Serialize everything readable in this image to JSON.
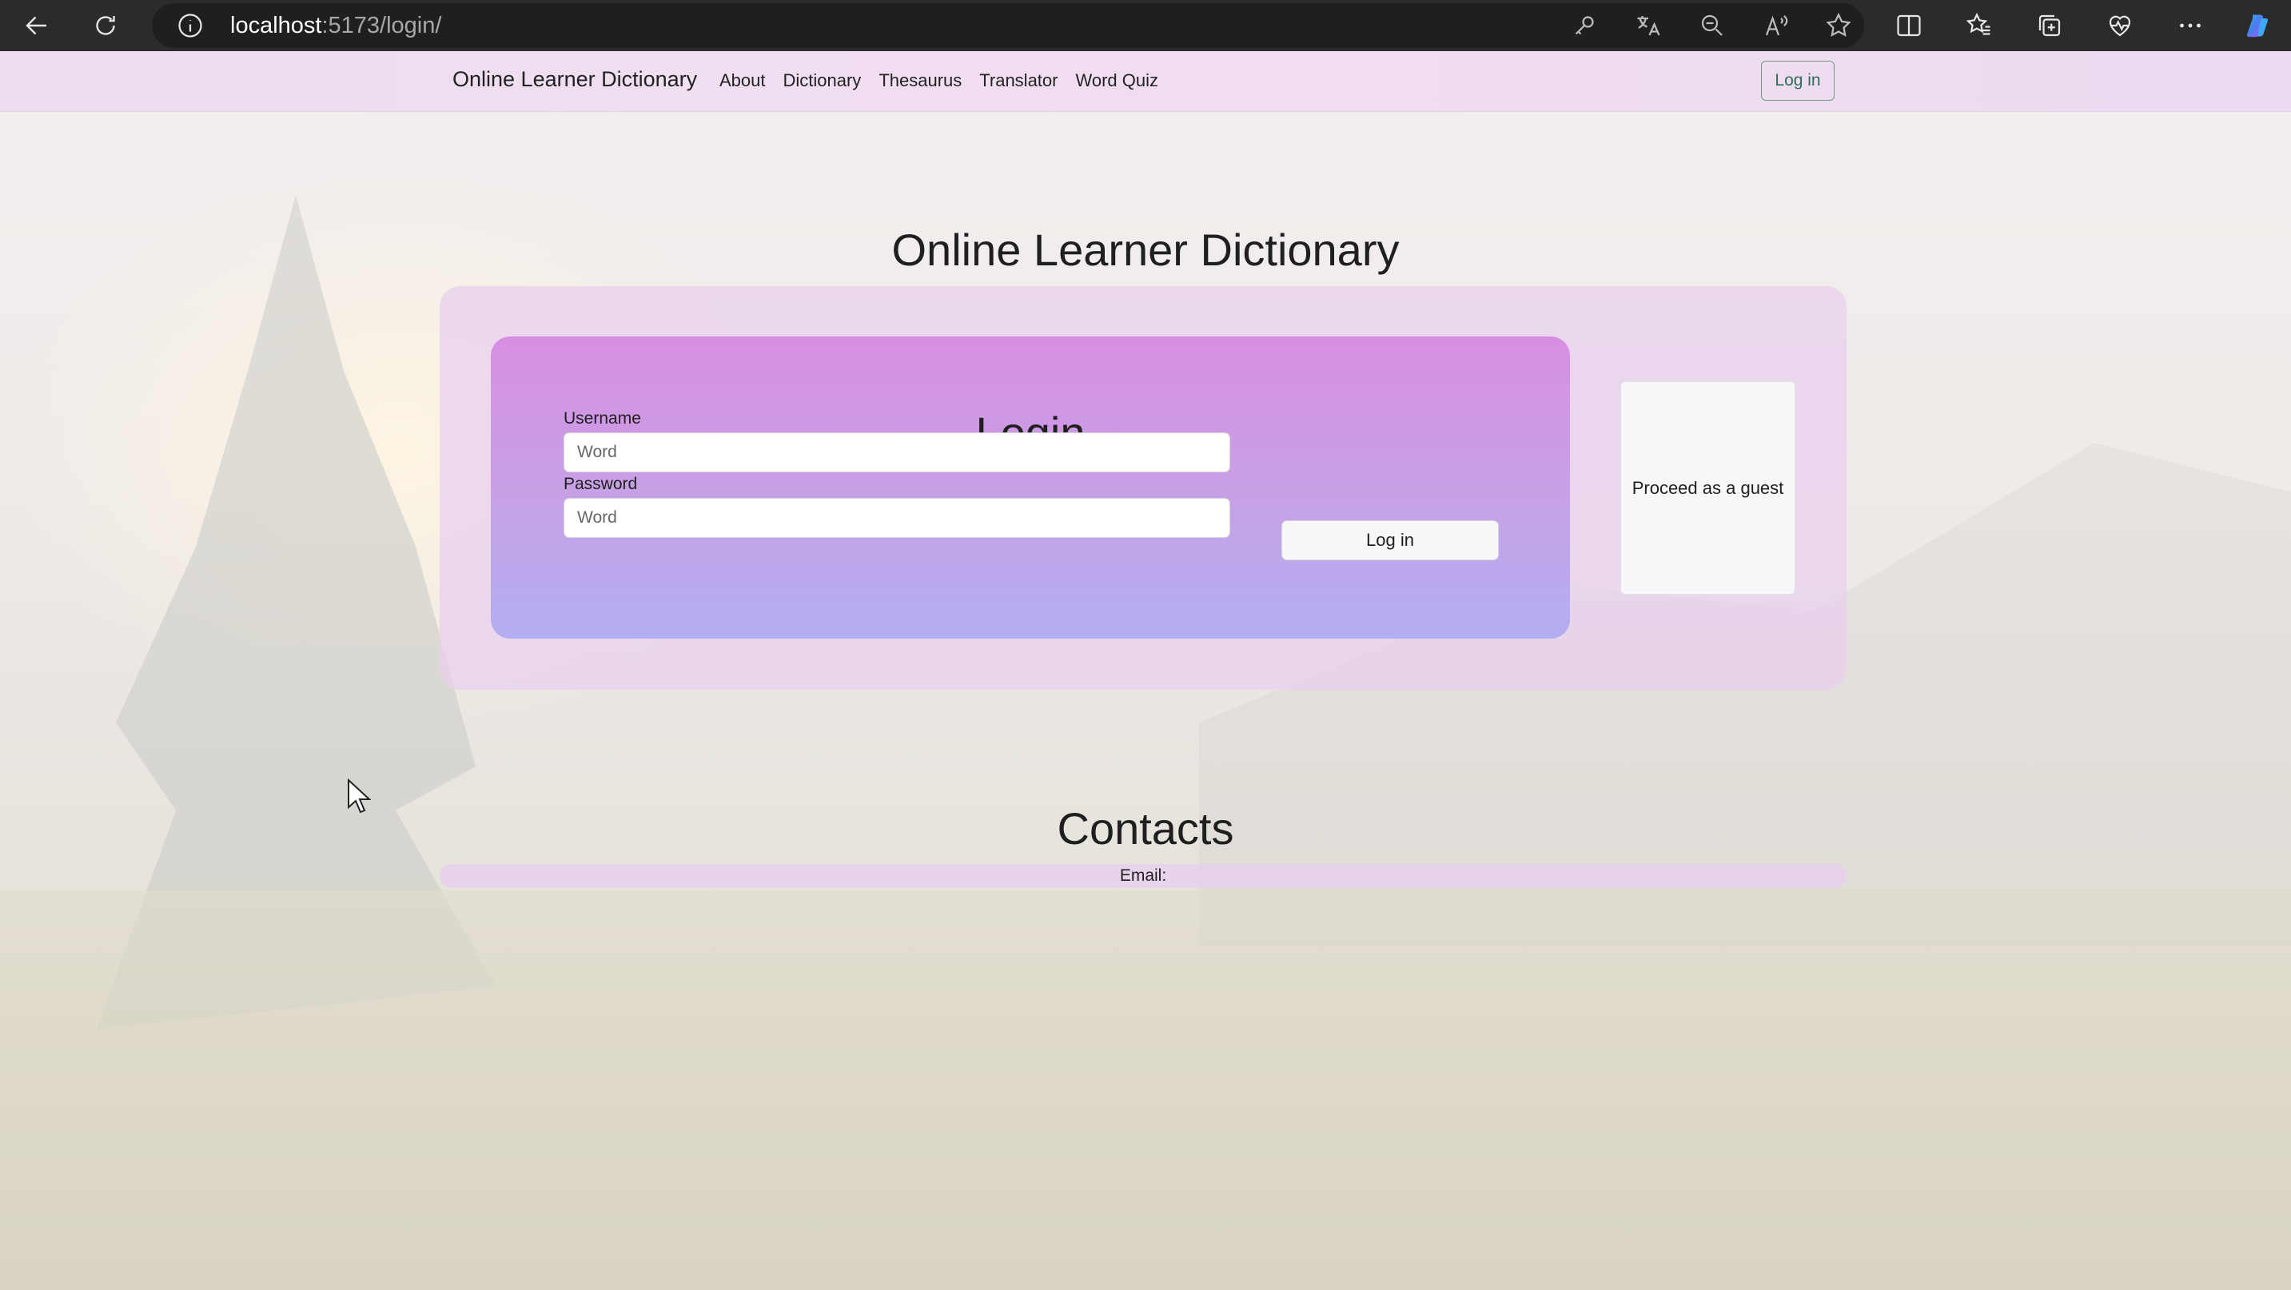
{
  "browser": {
    "url_host": "localhost",
    "url_rest": ":5173/login/"
  },
  "navbar": {
    "brand": "Online Learner Dictionary",
    "links": [
      "About",
      "Dictionary",
      "Thesaurus",
      "Translator",
      "Word Quiz"
    ],
    "login_label": "Log in"
  },
  "main": {
    "title": "Online Learner Dictionary",
    "login": {
      "heading": "Login",
      "username_label": "Username",
      "username_placeholder": "Word",
      "password_label": "Password",
      "password_placeholder": "Word",
      "submit_label": "Log in"
    },
    "guest_label": "Proceed as a guest"
  },
  "contacts": {
    "title": "Contacts",
    "email_label": "Email:"
  },
  "colors": {
    "navbar": "#efdcef",
    "login_card_top": "#d78ee2",
    "login_card_bottom": "#b3aef1",
    "nav_login_border": "#6f9a86"
  }
}
